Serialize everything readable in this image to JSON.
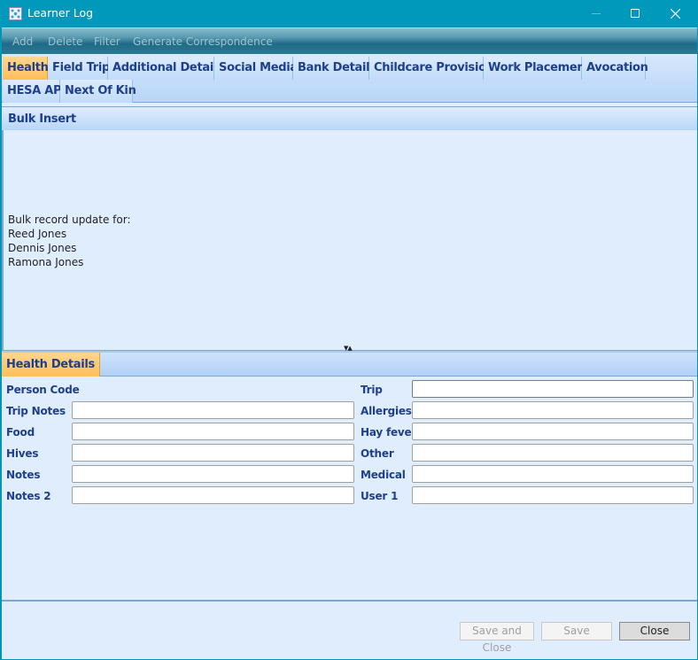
{
  "window": {
    "title": "Learner Log",
    "app_icon": "app-grid-icon",
    "controls": {
      "minimize": "minimize-icon",
      "maximize": "maximize-icon",
      "close": "close-icon"
    }
  },
  "toolbar": {
    "items": [
      {
        "label": "Add",
        "enabled": false
      },
      {
        "label": "Delete",
        "enabled": false
      },
      {
        "label": "Filter",
        "enabled": false
      },
      {
        "label": "Generate Correspondence",
        "enabled": false
      }
    ]
  },
  "tabs": {
    "active": "Health",
    "row1": [
      "Health",
      "Field Trip",
      "Additional Details",
      "Social Media",
      "Bank Details",
      "Childcare Provision",
      "Work Placement",
      "Avocation"
    ],
    "row2": [
      "HESA AP",
      "Next Of Kin"
    ]
  },
  "bulk_insert": {
    "header": "Bulk Insert",
    "intro": "Bulk record update for:",
    "names": [
      "Reed Jones",
      "Dennis Jones",
      "Ramona Jones"
    ]
  },
  "health_details": {
    "tab_label": "Health Details",
    "left_fields": [
      {
        "label": "Person Code",
        "value": null
      },
      {
        "label": "Trip Notes",
        "value": ""
      },
      {
        "label": "Food",
        "value": ""
      },
      {
        "label": "Hives",
        "value": ""
      },
      {
        "label": "Notes",
        "value": ""
      },
      {
        "label": "Notes 2",
        "value": ""
      }
    ],
    "right_fields": [
      {
        "label": "Trip",
        "value": ""
      },
      {
        "label": "Allergies",
        "value": ""
      },
      {
        "label": "Hay fever",
        "value": ""
      },
      {
        "label": "Other",
        "value": ""
      },
      {
        "label": "Medical",
        "value": ""
      },
      {
        "label": "User 1",
        "value": ""
      }
    ]
  },
  "footer": {
    "save_and_close": "Save and Close",
    "save": "Save",
    "close": "Close"
  }
}
